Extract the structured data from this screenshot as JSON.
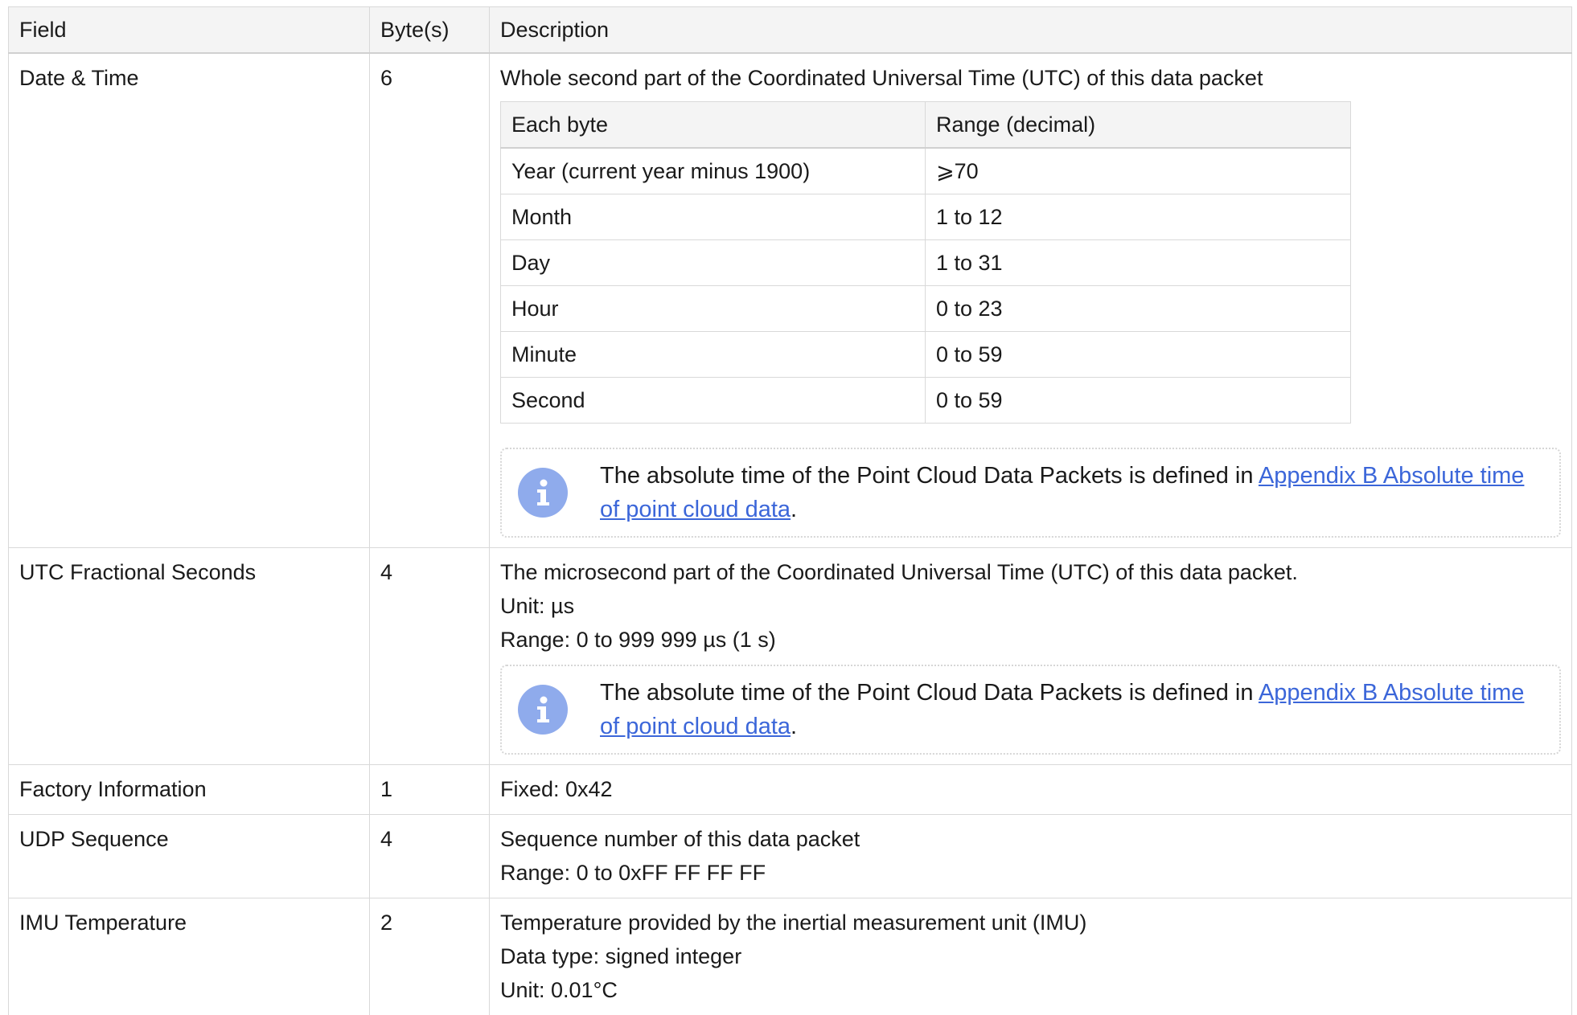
{
  "table": {
    "headers": {
      "field": "Field",
      "bytes": "Byte(s)",
      "description": "Description"
    },
    "rows": [
      {
        "field": "Date & Time",
        "bytes": "6",
        "description": [
          "Whole second part of the Coordinated Universal Time (UTC) of this data packet"
        ],
        "subtable": {
          "headers": {
            "each_byte": "Each byte",
            "range": "Range (decimal)"
          },
          "rows": [
            {
              "each_byte": "Year (current year minus 1900)",
              "range": "⩾70"
            },
            {
              "each_byte": "Month",
              "range": "1 to 12"
            },
            {
              "each_byte": "Day",
              "range": "1 to 31"
            },
            {
              "each_byte": "Hour",
              "range": "0 to 23"
            },
            {
              "each_byte": "Minute",
              "range": "0 to 59"
            },
            {
              "each_byte": "Second",
              "range": "0 to 59"
            }
          ]
        },
        "note": {
          "icon": "info-icon",
          "text": "The absolute time of the Point Cloud Data Packets is defined in ",
          "link_text": "Appendix B Absolute time of point cloud data",
          "suffix": "."
        }
      },
      {
        "field": "UTC Fractional Seconds",
        "bytes": "4",
        "description": [
          "The microsecond part of the Coordinated Universal Time (UTC) of this data packet.",
          "Unit: µs",
          "Range: 0 to 999 999 µs (1 s)"
        ],
        "note": {
          "icon": "info-icon",
          "text": "The absolute time of the Point Cloud Data Packets is defined in ",
          "link_text": "Appendix B Absolute time of point cloud data",
          "suffix": "."
        }
      },
      {
        "field": "Factory Information",
        "bytes": "1",
        "description": [
          "Fixed: 0x42"
        ]
      },
      {
        "field": "UDP Sequence",
        "bytes": "4",
        "description": [
          "Sequence number of this data packet",
          "Range: 0 to 0xFF FF FF FF"
        ]
      },
      {
        "field": "IMU Temperature",
        "bytes": "2",
        "description": [
          "Temperature provided by the inertial measurement unit (IMU)",
          "Data type: signed integer",
          "Unit: 0.01°C"
        ]
      }
    ]
  },
  "colors": {
    "header_bg": "#f4f4f4",
    "border": "#d9d9d9",
    "link": "#3b66d9",
    "info_icon_bg": "#8fabec"
  }
}
